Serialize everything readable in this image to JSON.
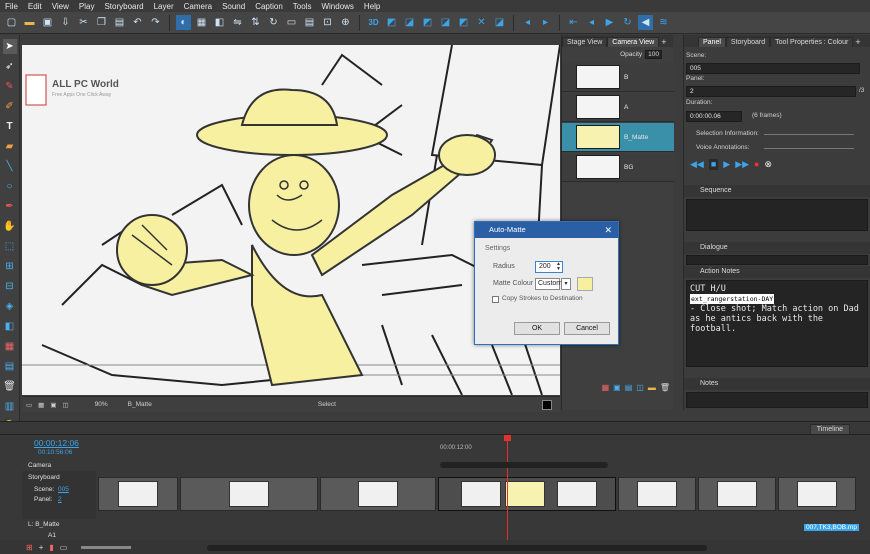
{
  "menu": [
    "File",
    "Edit",
    "View",
    "Play",
    "Storyboard",
    "Layer",
    "Camera",
    "Sound",
    "Caption",
    "Tools",
    "Windows",
    "Help"
  ],
  "watermark": {
    "title": "ALL PC World",
    "subtitle": "Free Apps One Click Away"
  },
  "view_tabs": {
    "stage": "Stage View",
    "camera": "Camera View"
  },
  "opacity": {
    "label": "Opacity",
    "value": "100"
  },
  "layers": [
    {
      "name": "B",
      "selected": false
    },
    {
      "name": "A",
      "selected": false
    },
    {
      "name": "B_Matte",
      "selected": true
    },
    {
      "name": "BG",
      "selected": false
    }
  ],
  "stage_status": {
    "zoom": "90%",
    "layer": "B_Matte",
    "mode": "Select"
  },
  "right_tabs": {
    "panel": "Panel",
    "storyboard": "Storyboard",
    "tool_props": "Tool Properties : Colour"
  },
  "scene": {
    "label": "Scene:",
    "value": "005"
  },
  "panel": {
    "label": "Panel:",
    "value": "2",
    "total": "/3"
  },
  "duration": {
    "label": "Duration:",
    "value": "0:00:00.06",
    "frames": "(6 frames)"
  },
  "selection_info": "Selection Information:",
  "voice_annotations": "Voice Annotations:",
  "sections": {
    "sequence": "Sequence",
    "dialogue": "Dialogue",
    "action_notes": "Action Notes",
    "notes": "Notes"
  },
  "action_notes": {
    "line1": "CUT H/U",
    "highlight": "ext_rangerstation-DAY",
    "body": "- Close shot; Match action on Dad as he antics back with the football."
  },
  "dialog": {
    "title": "Auto-Matte",
    "group": "Settings",
    "radius_label": "Radius",
    "radius_value": "200",
    "matte_label": "Matte Colour",
    "matte_value": "Custom",
    "checkbox_label": "Copy Strokes to Destination",
    "ok": "OK",
    "cancel": "Cancel",
    "swatch_color": "#f6f0a0"
  },
  "timeline": {
    "tab": "Timeline",
    "time_main": "00:00:12:06",
    "time_sub": "00:10:56:06",
    "ruler_mark": "00:00:12:00",
    "camera_label": "Camera",
    "storyboard_label": "Storyboard",
    "scene_label": "Scene:",
    "scene_value": "005",
    "panel_label": "Panel:",
    "panel_value": "2",
    "layer_label": "L: B_Matte",
    "audio_label": "A1",
    "footer_right": "007,TK3,BOB.mp"
  },
  "colors": {
    "accent": "#3aa5ea",
    "selected_layer": "#3a90a8",
    "sketch_fill": "#f6f0a0",
    "playhead": "#e03030"
  }
}
